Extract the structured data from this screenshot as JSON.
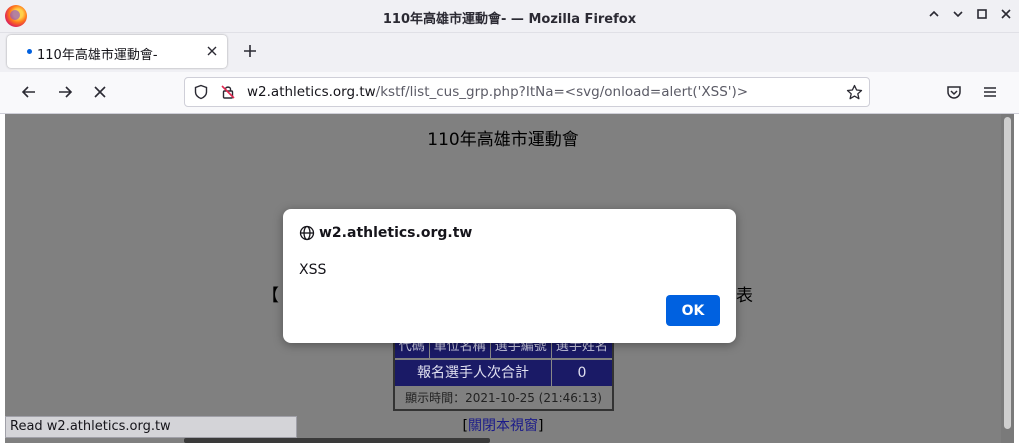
{
  "window": {
    "title": "110年高雄市運動會- — Mozilla Firefox"
  },
  "tabs": [
    {
      "label": "110年高雄市運動會-",
      "active": true
    }
  ],
  "navbar": {
    "url_host": "w2.athletics.org.tw",
    "url_rest": "/kstf/list_cus_grp.php?ItNa=<svg/onload=alert('XSS')>"
  },
  "page": {
    "heading": "110年高雄市運動會",
    "bracket_left": "【",
    "bracket_right": "表",
    "table": {
      "headers": [
        "代碼",
        "單位名稱",
        "選手編號",
        "選手姓名"
      ],
      "summary_label": "報名選手人次合計",
      "summary_value": "0",
      "display_time": "顯示時間：2021-10-25 (21:46:13)"
    },
    "close_link": {
      "open": "[",
      "label": "關閉本視窗",
      "close": "]"
    }
  },
  "status": {
    "text": "Read w2.athletics.org.tw"
  },
  "dialog": {
    "origin": "w2.athletics.org.tw",
    "message": "XSS",
    "ok_label": "OK"
  },
  "colors": {
    "accent": "#0061e0",
    "page_background": "#808080",
    "table_header": "#1a1a66"
  }
}
